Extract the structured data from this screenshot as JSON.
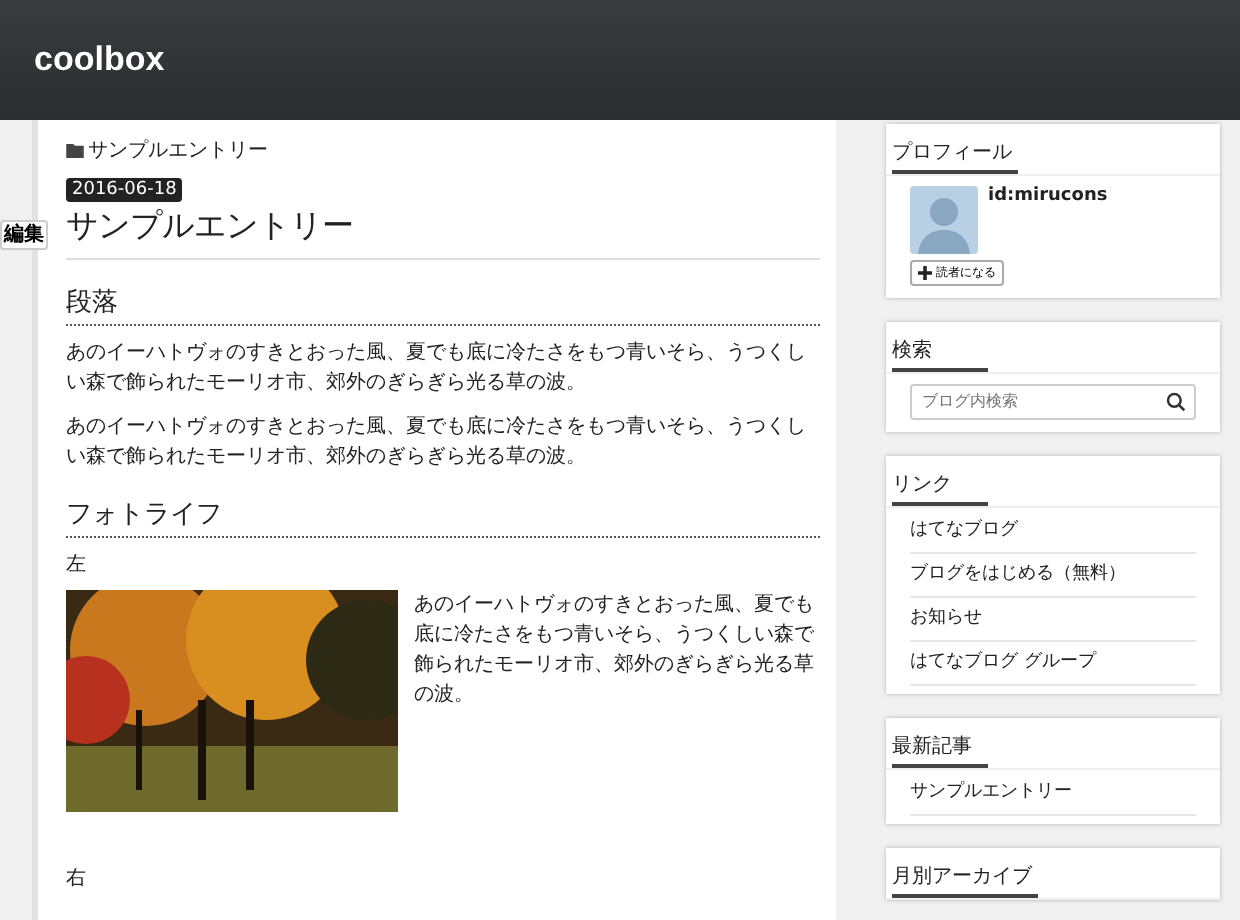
{
  "header": {
    "title": "coolbox"
  },
  "entry": {
    "category": "サンプルエントリー",
    "date": "2016-06-18",
    "title": "サンプルエントリー",
    "edit_button": "編集",
    "sections": [
      {
        "heading": "段落",
        "paragraphs": [
          "あのイーハトヴォのすきとおった風、夏でも底に冷たさをもつ青いそら、うつくしい森で飾られたモーリオ市、郊外のぎらぎら光る草の波。",
          "あのイーハトヴォのすきとおった風、夏でも底に冷たさをもつ青いそら、うつくしい森で飾られたモーリオ市、郊外のぎらぎら光る草の波。"
        ]
      },
      {
        "heading": "フォトライフ",
        "figures": [
          {
            "kind": "photo",
            "label": "左",
            "caption": "あのイーハトヴォのすきとおった風、夏でも底に冷たさをもつ青いそら、うつくしい森で飾られたモーリオ市、郊外のぎらぎら光る草の波。"
          },
          {
            "kind": "label",
            "label": "右"
          }
        ]
      }
    ]
  },
  "sidebar": [
    {
      "kind": "profile",
      "title": "プロフィール",
      "user": "id:mirucons",
      "button": "読者になる"
    },
    {
      "kind": "search",
      "title": "検索",
      "placeholder": "ブログ内検索"
    },
    {
      "kind": "links",
      "title": "リンク",
      "items": [
        "はてなブログ",
        "ブログをはじめる（無料）",
        "お知らせ",
        "はてなブログ グループ"
      ]
    },
    {
      "kind": "links",
      "title": "最新記事",
      "items": [
        "サンプルエントリー"
      ]
    },
    {
      "kind": "archive",
      "title": "月別アーカイブ"
    }
  ]
}
